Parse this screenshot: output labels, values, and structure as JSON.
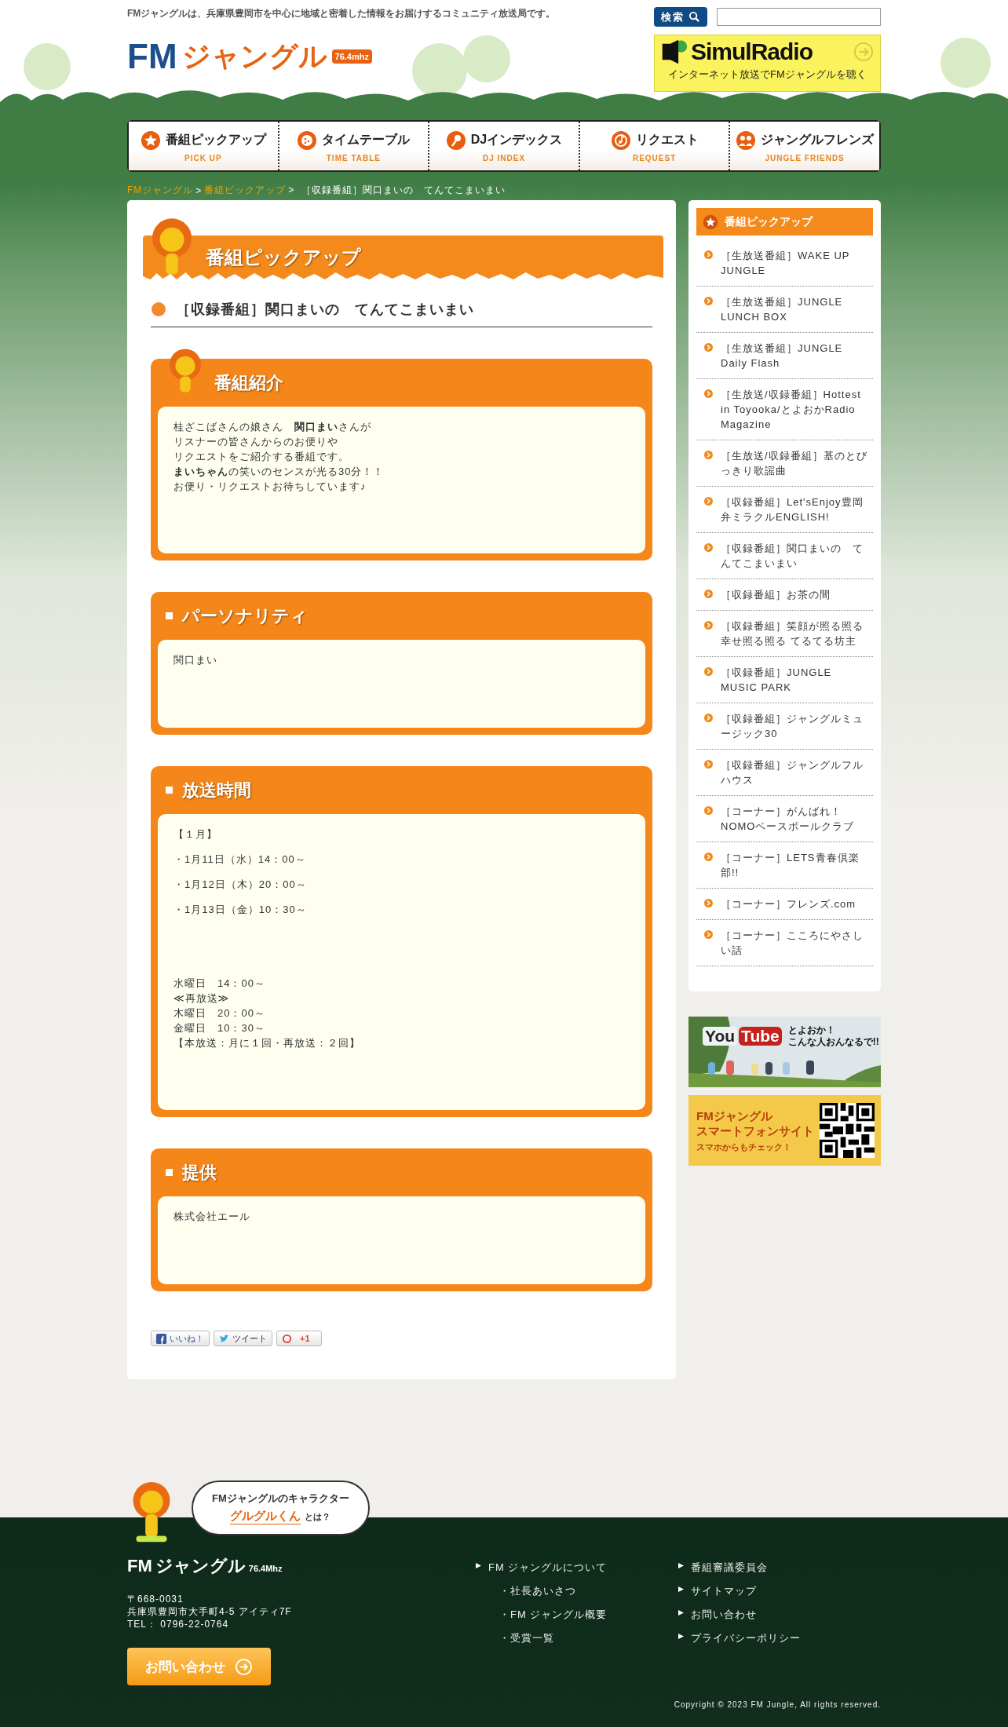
{
  "header": {
    "tagline": "FMジャングルは、兵庫県豊岡市を中心に地域と密着した情報をお届けするコミュニティ放送局です。",
    "logo": {
      "fm": "FM",
      "name": "ジャングル",
      "freq": "76.4mhz"
    },
    "search": {
      "button": "検索"
    },
    "simulradio": {
      "title": "SimulRadio",
      "subtitle": "インターネット放送でFMジャングルを聴く"
    }
  },
  "nav": [
    {
      "label": "番組ピックアップ",
      "sub": "PICK UP",
      "kind": "star"
    },
    {
      "label": "タイムテーブル",
      "sub": "TIME TABLE",
      "kind": "clock"
    },
    {
      "label": "DJインデックス",
      "sub": "DJ INDEX",
      "kind": "mic"
    },
    {
      "label": "リクエスト",
      "sub": "REQUEST",
      "kind": "note"
    },
    {
      "label": "ジャングルフレンズ",
      "sub": "JUNGLE FRIENDS",
      "kind": "people"
    }
  ],
  "breadcrumb": [
    {
      "label": "FMジャングル",
      "link": true
    },
    {
      "label": ">",
      "link": false
    },
    {
      "label": "番組ピックアップ",
      "link": true
    },
    {
      "label": ">  ［収録番組］関口まいの　てんてこまいまい",
      "link": false
    }
  ],
  "main": {
    "banner": "番組ピックアップ",
    "title": "［収録番組］関口まいの　てんてこまいまい",
    "sections": [
      {
        "title": "番組紹介",
        "kind": "mascot",
        "paragraphs": [
          [
            "桂ざこばさんの娘さん　**関口まい**さんが",
            "リスナーの皆さんからのお便りや",
            "リクエストをご紹介する番組です。",
            "**まいちゃん**の笑いのセンスが光る30分！！",
            "お便り・リクエストお待ちしています♪"
          ]
        ]
      },
      {
        "title": "パーソナリティ",
        "kind": "square",
        "paragraphs": [
          [
            "関口まい"
          ]
        ]
      },
      {
        "title": "放送時間",
        "kind": "square",
        "paragraphs": [
          [
            "【１月】"
          ],
          [
            "・1月11日（水）14：00～"
          ],
          [
            "・1月12日（木）20：00～"
          ],
          [
            "・1月13日（金）10：30～"
          ],
          [
            "水曜日　14：00～",
            "≪再放送≫",
            "木曜日　20：00～",
            "金曜日　10：30～",
            "【本放送：月に１回・再放送：２回】"
          ]
        ]
      },
      {
        "title": "提供",
        "kind": "square",
        "paragraphs": [
          [
            "株式会社エール"
          ]
        ]
      }
    ],
    "social": [
      {
        "label": "いいね！",
        "kind": "like"
      },
      {
        "label": "ツイート",
        "kind": "tweet"
      },
      {
        "label": "+1",
        "kind": "plus"
      }
    ]
  },
  "sidebar": {
    "title": "番組ピックアップ",
    "items": [
      "［生放送番組］WAKE UP JUNGLE",
      "［生放送番組］JUNGLE LUNCH BOX",
      "［生放送番組］JUNGLE Daily Flash",
      "［生放送/収録番組］Hottest in Toyooka/とよおかRadio Magazine",
      "［生放送/収録番組］基のとびっきり歌謡曲",
      "［収録番組］Let'sEnjoy豊岡弁ミラクルENGLISH!",
      "［収録番組］関口まいの　てんてこまいまい",
      "［収録番組］お茶の間",
      "［収録番組］笑顔が照る照る幸せ照る照る てるてる坊主",
      "［収録番組］JUNGLE MUSIC PARK",
      "［収録番組］ジャングルミュージック30",
      "［収録番組］ジャングルフルハウス",
      "［コーナー］がんばれ！NOMOベースボールクラブ",
      "［コーナー］LETS青春倶楽部!!",
      "［コーナー］フレンズ.com",
      "［コーナー］こころにやさしい話"
    ],
    "youtube": {
      "you": "You",
      "tube": "Tube",
      "line1": "とよおか！",
      "line2": "こんな人おんなるで!!"
    },
    "smartphone": {
      "line1": "FMジャングル",
      "line2": "スマートフォンサイト",
      "line3": "スマホからもチェック！"
    }
  },
  "footer": {
    "bubble": {
      "line1": "FMジャングルのキャラクター",
      "name": "グルグルくん",
      "suffix": "とは？"
    },
    "logo": {
      "fm": "FM",
      "name": "ジャングル",
      "freq": "76.4Mhz"
    },
    "address": [
      "〒668-0031",
      "兵庫県豊岡市大手町4-5 アイティ7F",
      "TEL： 0796-22-0764"
    ],
    "contact": "お問い合わせ",
    "links1": [
      {
        "label": "FM ジャングルについて",
        "children": [
          {
            "label": "・社長あいさつ"
          },
          {
            "label": "・FM ジャングル概要"
          },
          {
            "label": "・受賞一覧"
          }
        ]
      }
    ],
    "links2": [
      {
        "label": "番組審議委員会"
      },
      {
        "label": "サイトマップ"
      },
      {
        "label": "お問い合わせ"
      },
      {
        "label": "プライバシーポリシー"
      }
    ],
    "copyright": "Copyright © 2023 FM Jungle, All rights reserved."
  }
}
